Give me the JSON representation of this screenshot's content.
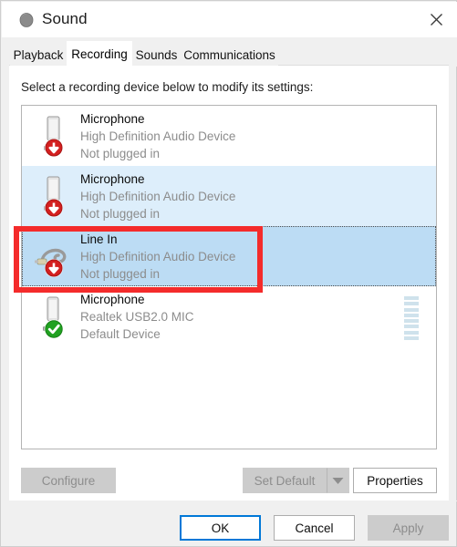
{
  "window": {
    "title": "Sound",
    "icon": "speaker-icon",
    "close_label": "✕"
  },
  "tabs": [
    {
      "label": "Playback",
      "active": false
    },
    {
      "label": "Recording",
      "active": true
    },
    {
      "label": "Sounds",
      "active": false
    },
    {
      "label": "Communications",
      "active": false
    }
  ],
  "main": {
    "instruction": "Select a recording device below to modify its settings:"
  },
  "devices": [
    {
      "name": "Microphone",
      "description": "High Definition Audio Device",
      "status": "Not plugged in",
      "icon": "microphone-jack-icon",
      "badge": "red-down-arrow-badge",
      "state": "normal",
      "meter": false
    },
    {
      "name": "Microphone",
      "description": "High Definition Audio Device",
      "status": "Not plugged in",
      "icon": "microphone-jack-icon",
      "badge": "red-down-arrow-badge",
      "state": "highlight",
      "meter": false
    },
    {
      "name": "Line In",
      "description": "High Definition Audio Device",
      "status": "Not plugged in",
      "icon": "line-in-cable-icon",
      "badge": "red-down-arrow-badge",
      "state": "selected",
      "meter": false
    },
    {
      "name": "Microphone",
      "description": "Realtek USB2.0 MIC",
      "status": "Default Device",
      "icon": "usb-microphone-icon",
      "badge": "green-check-badge",
      "state": "normal",
      "meter": true
    }
  ],
  "buttons": {
    "configure": "Configure",
    "set_default": "Set Default",
    "set_default_arrow": "▼",
    "properties": "Properties",
    "ok": "OK",
    "cancel": "Cancel",
    "apply": "Apply"
  },
  "colors": {
    "annotation": "#f42b2b",
    "focus": "#0078d7",
    "selected_row": "#bcdcf4",
    "highlight_row": "#ddeefb",
    "status_ok": "#21a121",
    "badge_red": "#d32020",
    "meter_segment": "#cfe2ec"
  }
}
